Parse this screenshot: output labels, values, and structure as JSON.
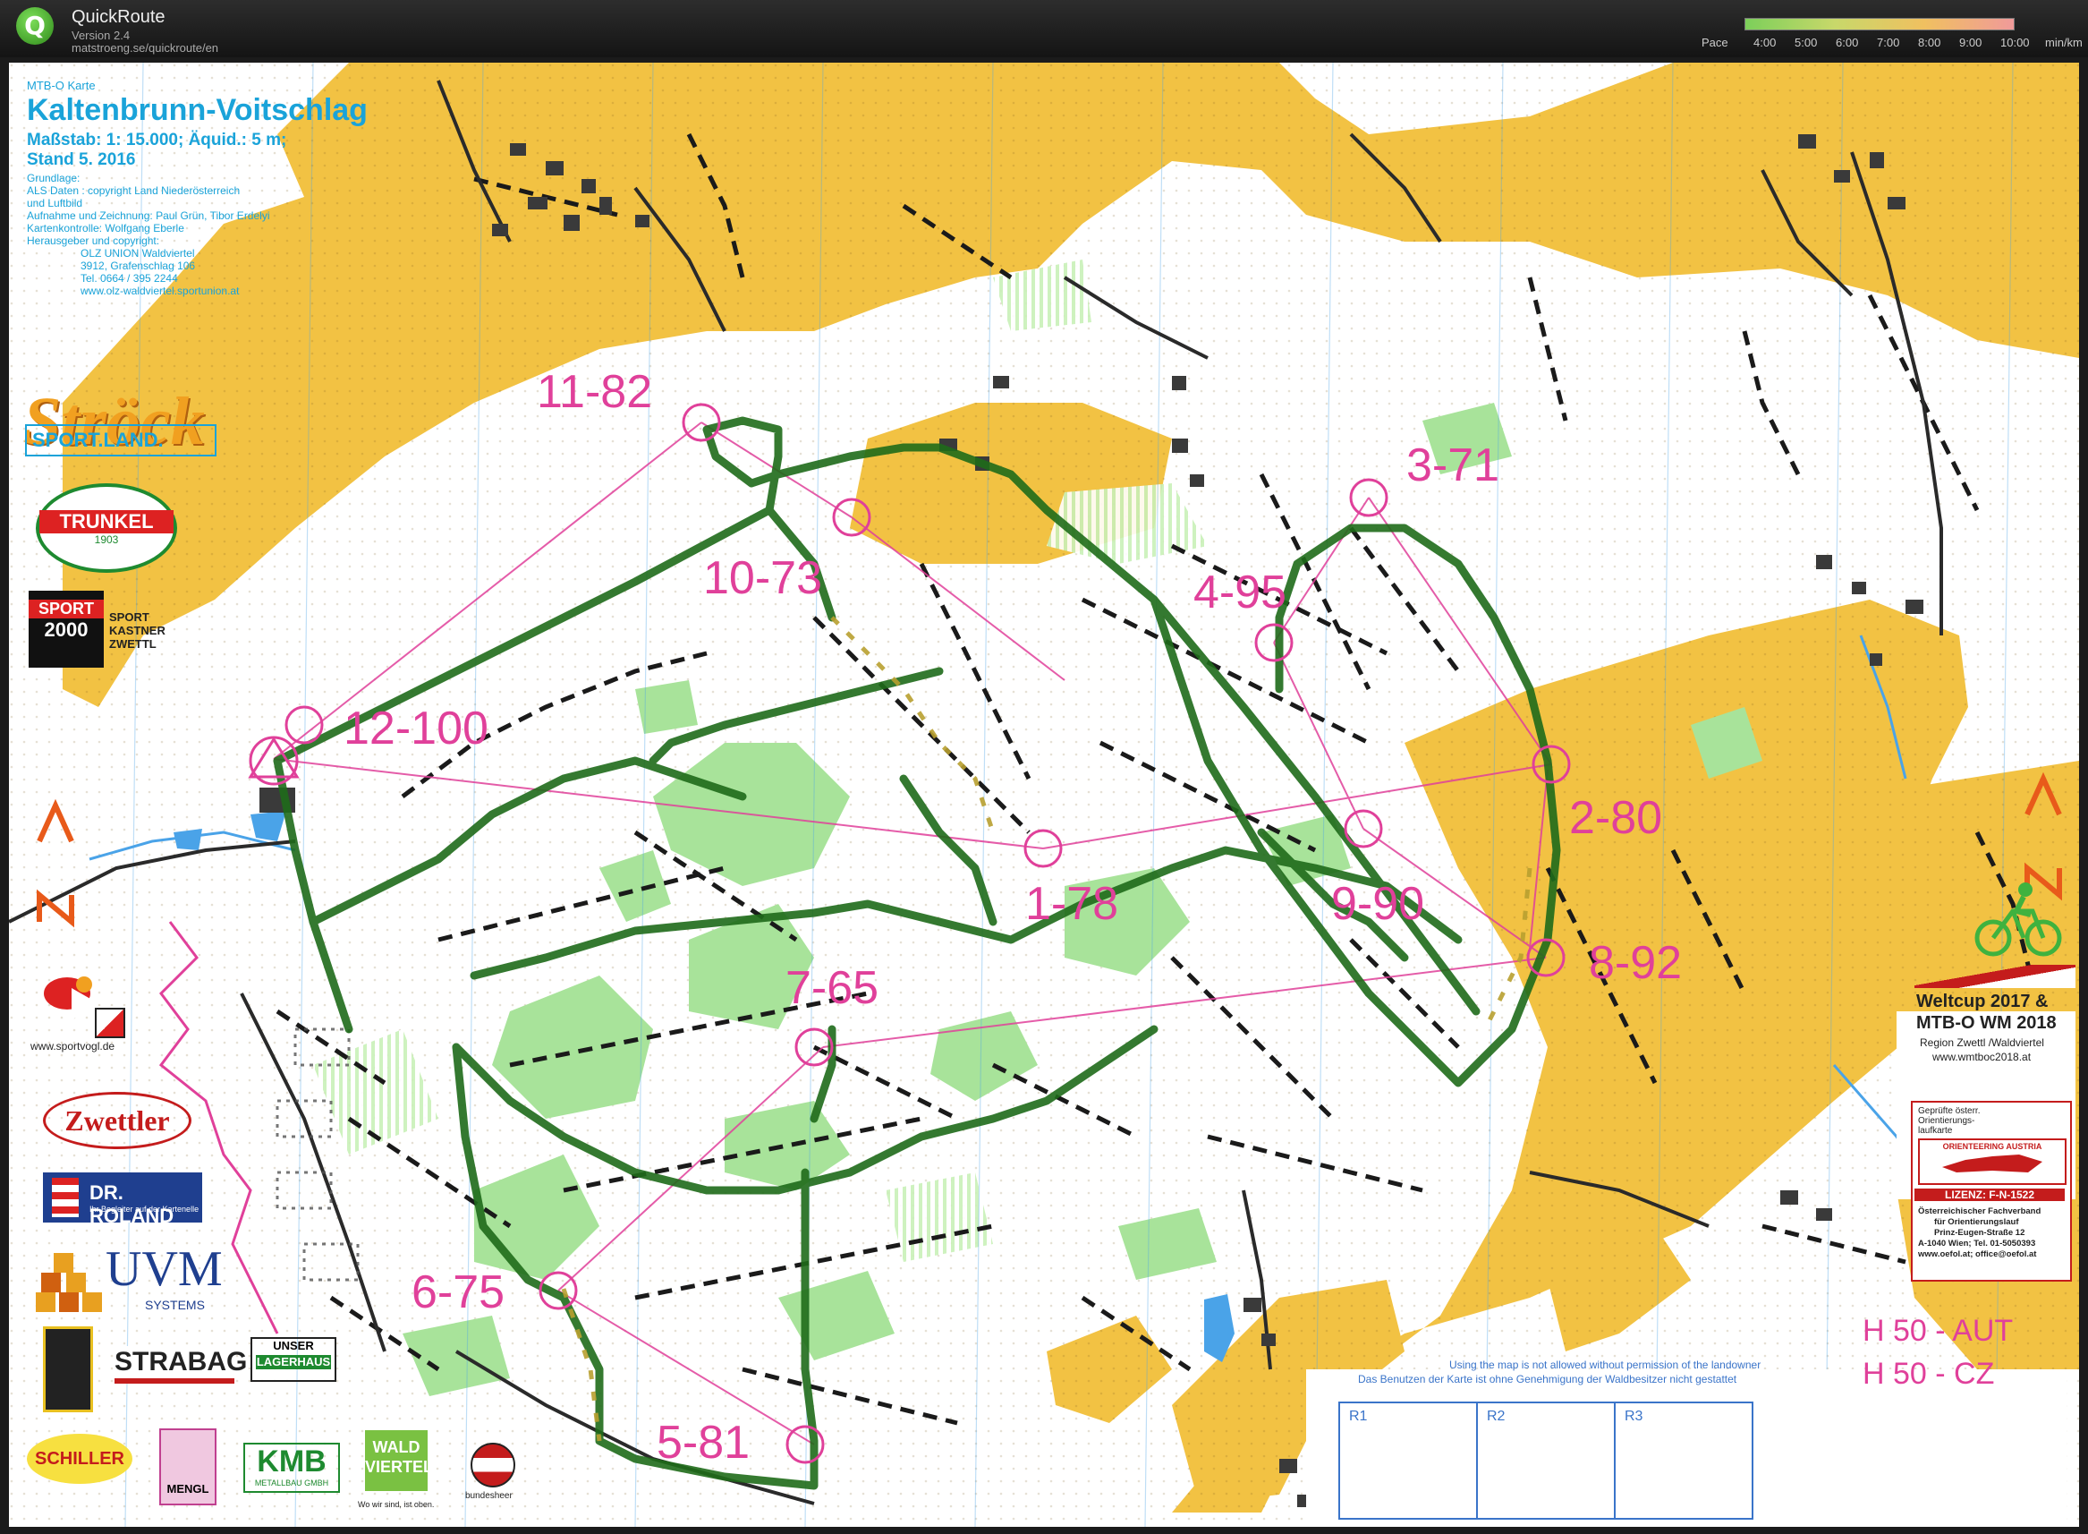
{
  "app": {
    "title": "QuickRoute",
    "version": "Version 2.4",
    "url": "matstroeng.se/quickroute/en"
  },
  "pace_legend": {
    "label": "Pace",
    "ticks": [
      "4:00",
      "5:00",
      "6:00",
      "7:00",
      "8:00",
      "9:00",
      "10:00"
    ],
    "unit": "min/km"
  },
  "map_info": {
    "type_line": "MTB-O Karte",
    "title": "Kaltenbrunn-Voitschlag",
    "scale": "Maßstab: 1: 15.000; Äquid.: 5 m;",
    "stand": "Stand 5. 2016",
    "credits": [
      "Grundlage:",
      "ALS Daten : copyright Land Niederösterreich",
      "und Luftbild",
      "Aufnahme und Zeichnung: Paul Grün, Tibor Erdelyi",
      "Kartenkontrolle: Wolfgang Eberle",
      "Herausgeber und copyright:",
      "OLZ UNION Waldviertel",
      "3912, Grafenschlag 106",
      "Tel. 0664 / 395 2244",
      "www.olz-waldviertel.sportunion.at"
    ]
  },
  "controls": [
    {
      "label": "11-82"
    },
    {
      "label": "10-73"
    },
    {
      "label": "12-100"
    },
    {
      "label": "3-71"
    },
    {
      "label": "4-95"
    },
    {
      "label": "2-80"
    },
    {
      "label": "1-78"
    },
    {
      "label": "9-90"
    },
    {
      "label": "8-92"
    },
    {
      "label": "7-65"
    },
    {
      "label": "6-75"
    },
    {
      "label": "5-81"
    }
  ],
  "sponsors": {
    "stroeck": "Ströck",
    "sportland": "SPORT.LAND.",
    "trunkel": "TRUNKEL",
    "trunkel_year": "1903",
    "sport2000_a": "SPORT",
    "sport2000_b": "2000",
    "kastner": [
      "SPORT",
      "KASTNER",
      "ZWETTL"
    ],
    "sportvogl": "www.sportvogl.de",
    "zwettler": "Zwettler",
    "drroland": "DR. ROLAND",
    "drroland_sub": "Ihr Begleiter auf der Kartenelle",
    "uvm": "UVM",
    "uvm_sub": "SYSTEMS",
    "strabag": "STRABAG",
    "lagerhaus": [
      "UNSER",
      "LAGERHAUS"
    ],
    "schiller": "SCHILLER",
    "mengl": "MENGL",
    "kmb": "KMB",
    "kmb_sub": "METALLBAU GMBH",
    "waldviertel": [
      "WALD",
      "VIERTEL"
    ],
    "waldviertel_sub": "Wo wir sind, ist oben.",
    "bundesheer": "bundesheer"
  },
  "weltcup": {
    "line1": "Weltcup 2017 &",
    "line2": "MTB-O WM 2018",
    "line3": "Region Zwettl /Waldviertel",
    "line4": "www.wmtboc2018.at"
  },
  "license": {
    "top": [
      "Geprüfte österr.",
      "Orientierungs-",
      "laufkarte"
    ],
    "org": "ORIENTEERING AUSTRIA",
    "lizenz": "LIZENZ: F-N-1522",
    "lines": [
      "Österreichischer Fachverband",
      "für Orientierungslauf",
      "Prinz-Eugen-Straße 12",
      "A-1040 Wien; Tel. 01-5050393",
      "www.oefol.at; office@oefol.at"
    ]
  },
  "category": {
    "line1": "H 50 -  AUT",
    "line2": "H 50 -  CZ"
  },
  "notice": {
    "line1": "Using the map is not allowed without permission of the landowner",
    "line2": "Das Benutzen der Karte ist ohne Genehmigung der Waldbesitzer nicht gestattet"
  },
  "result_boxes": [
    "R1",
    "R2",
    "R3"
  ],
  "colors": {
    "open_land": "#f2c243",
    "forest_green": "#a8e39a",
    "course": "#e0409a",
    "route": "#1f6b1a",
    "info_blue": "#1aa3d9"
  }
}
